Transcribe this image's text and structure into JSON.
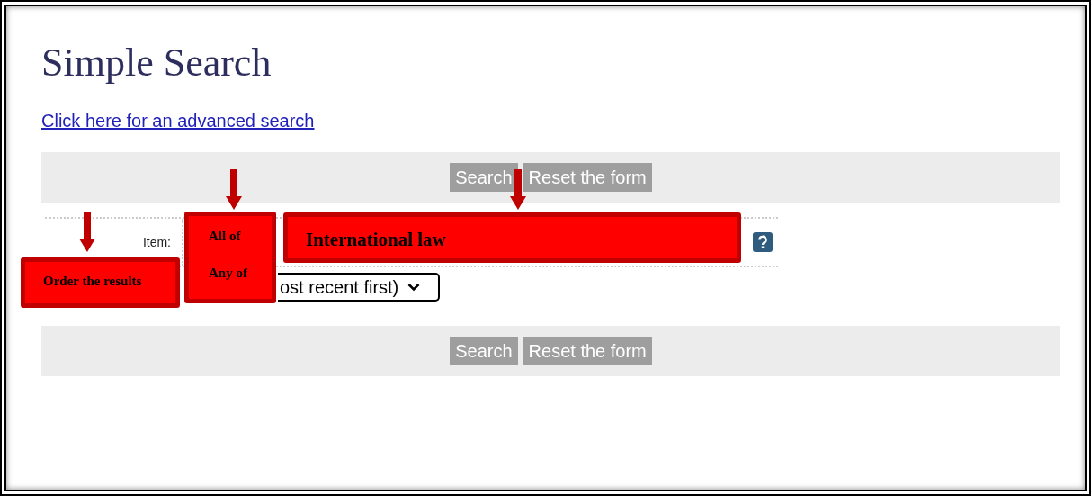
{
  "page": {
    "title": "Simple Search",
    "advanced_link": "Click here for an advanced search"
  },
  "top_buttons": [
    "Search",
    "Reset the form"
  ],
  "form": {
    "item_label": "Item:",
    "sort_value": "ost recent first)"
  },
  "bottom_buttons": [
    "Search",
    "Reset the form"
  ],
  "annotations": [
    {
      "kind": "callout",
      "texts": [
        "Order the results"
      ]
    },
    {
      "kind": "callout",
      "texts": [
        "All of",
        "Any of"
      ]
    },
    {
      "kind": "callout",
      "texts": [
        "International law"
      ]
    }
  ]
}
